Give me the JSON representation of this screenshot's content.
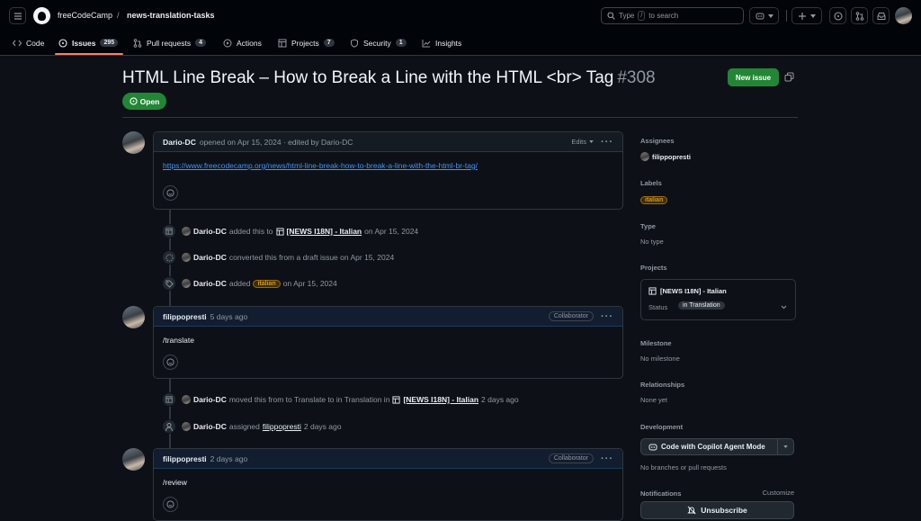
{
  "header": {
    "org": "freeCodeCamp",
    "separator": "/",
    "repo": "news-translation-tasks",
    "search_prefix": "Type",
    "search_key": "/",
    "search_suffix": "to search"
  },
  "nav": {
    "code": "Code",
    "issues": "Issues",
    "issues_count": "295",
    "pulls": "Pull requests",
    "pulls_count": "4",
    "actions": "Actions",
    "projects": "Projects",
    "projects_count": "7",
    "security": "Security",
    "security_count": "1",
    "insights": "Insights"
  },
  "issue": {
    "title": "HTML Line Break – How to Break a Line with the HTML <br> Tag",
    "number": "#308",
    "new_issue": "New issue",
    "status": "Open"
  },
  "comment1": {
    "author": "Dario-DC",
    "meta": "opened on Apr 15, 2024 · edited by Dario-DC",
    "edits": "Edits",
    "link": "https://www.freecodecamp.org/news/html-line-break-how-to-break-a-line-with-the-html-br-tag/"
  },
  "events1": [
    {
      "actor": "Dario-DC",
      "pre": "added this to",
      "target": "[NEWS I18N] - Italian",
      "post": "on Apr 15, 2024"
    },
    {
      "actor": "Dario-DC",
      "pre": "converted this from a draft issue on Apr 15, 2024"
    },
    {
      "actor": "Dario-DC",
      "pre": "added",
      "label": "italian",
      "post": "on Apr 15, 2024"
    }
  ],
  "comment2": {
    "author": "filippopresti",
    "meta": "5 days ago",
    "badge": "Collaborator",
    "body": "/translate"
  },
  "events2": [
    {
      "actor": "Dario-DC",
      "pre": "moved this from to Translate to in Translation in",
      "target": "[NEWS I18N] - Italian",
      "post": "2 days ago"
    },
    {
      "actor": "Dario-DC",
      "pre": "assigned",
      "target": "filippopresti",
      "post": "2 days ago"
    }
  ],
  "comment3": {
    "author": "filippopresti",
    "meta": "2 days ago",
    "badge": "Collaborator",
    "body": "/review"
  },
  "sidebar": {
    "assignees_h": "Assignees",
    "assignee": "filippopresti",
    "labels_h": "Labels",
    "label": "italian",
    "type_h": "Type",
    "type_v": "No type",
    "projects_h": "Projects",
    "project_name": "[NEWS I18N] - Italian",
    "status_label": "Status",
    "status_value": "in Translation",
    "milestone_h": "Milestone",
    "milestone_v": "No milestone",
    "relationships_h": "Relationships",
    "relationships_v": "None yet",
    "development_h": "Development",
    "copilot": "Code with Copilot Agent Mode",
    "dev_v": "No branches or pull requests",
    "notifications_h": "Notifications",
    "customize": "Customize",
    "unsubscribe": "Unsubscribe"
  },
  "colors": {
    "accent_green": "#238636",
    "label_yellow": "#d29922",
    "link": "#4493f8"
  }
}
